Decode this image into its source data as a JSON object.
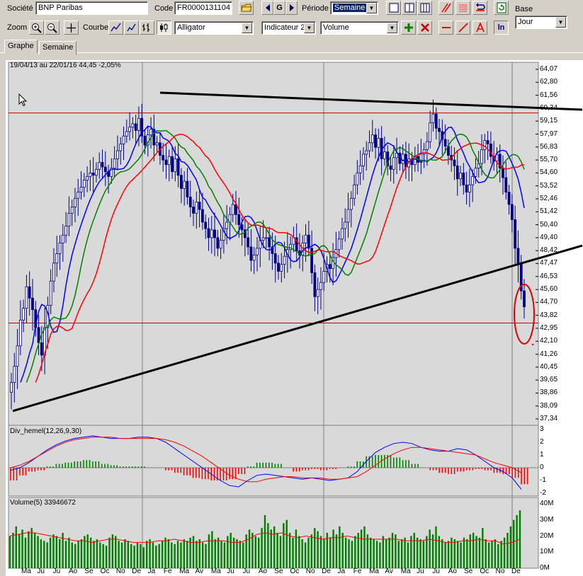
{
  "toolbar": {
    "company_label": "Société",
    "company_value": "BNP Paribas",
    "code_label": "Code",
    "code_value": "FR0000131104",
    "nav_g": "G",
    "period_label": "Période",
    "period_value": "Semaine",
    "base_label": "Base",
    "base_value": "Jour",
    "zoom_label": "Zoom",
    "curve_label": "Courbe",
    "overlay_value": "Alligator",
    "indicator_value": "Indicateur 2",
    "indicator2_value": "Volume",
    "ln_label": "ln"
  },
  "tabs": [
    {
      "label": "Graphe"
    },
    {
      "label": "Semaine"
    }
  ],
  "main_header": "19/04/13 au 22/01/16  44,45  -2,05%",
  "macd_header": "Div_hemel(12,26,9,30)",
  "volume_header": "Volume(5) 33946672",
  "colors": {
    "price_body": "#000080",
    "alligator_blue": "#0000ff",
    "alligator_green": "#008000",
    "alligator_red": "#ff0000",
    "hist_pos": "#008000",
    "hist_neg": "#ff0000",
    "volume_bar": "#008000",
    "volume_avg": "#ff0000",
    "trend_line": "#000000",
    "horizontal_line": "#c00000",
    "panel_bg": "#d9d9d9"
  },
  "chart_data": [
    {
      "type": "candlestick",
      "title": "19/04/13 au 22/01/16  44,45  -2,05%",
      "ylim": [
        37.34,
        64.07
      ],
      "yticks": [
        "64,07",
        "62,80",
        "61,56",
        "60,34",
        "59,15",
        "57,97",
        "56,83",
        "55,70",
        "54,60",
        "53,52",
        "52,46",
        "51,42",
        "50,40",
        "49,40",
        "48,42",
        "47,47",
        "46,53",
        "45,60",
        "44,70",
        "43,82",
        "42,95",
        "42,10",
        "41,26",
        "40,45",
        "39,65",
        "38,86",
        "38,09",
        "37,34"
      ],
      "xticks": [
        "Ma",
        "Ju",
        "Ju",
        "Ao",
        "Se",
        "Oc",
        "No",
        "De",
        "Ja",
        "Fe",
        "Ma",
        "Av",
        "Ma",
        "Ju",
        "Ju",
        "Ao",
        "Se",
        "Oc",
        "No",
        "De",
        "Ja",
        "Fe",
        "Ma",
        "Av",
        "Ma",
        "Ju",
        "Ju",
        "Ao",
        "Se",
        "Oc",
        "No",
        "De"
      ],
      "close": [
        39.5,
        40.5,
        41.8,
        43.5,
        44.3,
        45.8,
        45.0,
        44.2,
        43.0,
        42.0,
        41.2,
        43.0,
        44.5,
        46.2,
        47.5,
        48.2,
        49.0,
        49.6,
        50.3,
        51.3,
        51.8,
        52.5,
        53.0,
        53.4,
        54.0,
        54.3,
        54.6,
        54.4,
        54.9,
        55.5,
        55.1,
        54.7,
        54.3,
        55.0,
        55.8,
        56.5,
        57.1,
        57.8,
        58.2,
        58.6,
        58.9,
        58.3,
        59.4,
        57.8,
        57.0,
        57.9,
        58.4,
        57.0,
        57.2,
        56.1,
        55.7,
        55.3,
        56.0,
        54.7,
        55.8,
        54.4,
        53.3,
        53.9,
        52.6,
        51.8,
        51.3,
        52.2,
        51.6,
        50.6,
        50.1,
        49.4,
        50.0,
        49.4,
        48.6,
        49.2,
        50.1,
        50.6,
        51.2,
        52.0,
        51.2,
        50.4,
        50.0,
        49.4,
        48.7,
        47.7,
        48.1,
        48.6,
        49.2,
        49.4,
        49.4,
        48.7,
        48.2,
        47.5,
        46.9,
        47.4,
        48.0,
        48.5,
        48.9,
        49.4,
        48.4,
        48.1,
        49.0,
        49.6,
        48.6,
        46.8,
        45.1,
        45.6,
        46.1,
        46.9,
        47.4,
        47.1,
        47.9,
        48.5,
        49.3,
        50.1,
        50.6,
        51.6,
        52.5,
        53.6,
        54.6,
        55.2,
        56.2,
        56.5,
        57.2,
        57.9,
        56.8,
        57.6,
        55.8,
        56.4,
        55.2,
        54.9,
        55.9,
        56.3,
        55.4,
        56.2,
        55.1,
        55.8,
        55.3,
        56.0,
        55.5,
        56.2,
        56.6,
        57.3,
        59.0,
        59.8,
        58.5,
        58.2,
        57.5,
        56.9,
        56.1,
        55.7,
        55.2,
        54.1,
        54.6,
        53.6,
        53.0,
        53.6,
        54.3,
        55.0,
        55.4,
        56.6,
        57.4,
        57.1,
        56.0,
        55.6,
        56.2,
        55.0,
        54.2,
        53.0,
        52.0,
        50.8,
        48.6,
        47.5,
        45.5,
        44.4
      ],
      "horizontal_lines": [
        59.9,
        43.3
      ],
      "trend_lines": [
        {
          "from": [
            "2014-01",
            61.8
          ],
          "to": [
            "2016-01",
            60.2
          ]
        },
        {
          "from": [
            "2013-04",
            37.8
          ],
          "to": [
            "2016-01",
            48.8
          ]
        }
      ],
      "series": [
        {
          "name": "Alligator (blue)",
          "color": "#0000ff"
        },
        {
          "name": "Alligator (green)",
          "color": "#008000"
        },
        {
          "name": "Alligator (red)",
          "color": "#ff0000"
        }
      ],
      "annotation": "red ellipse around last candle"
    },
    {
      "type": "bar",
      "title": "Div_hemel(12,26,9,30)",
      "ylim": [
        -2,
        3
      ],
      "yticks": [
        "3",
        "2",
        "1",
        "0",
        "-1",
        "-2"
      ],
      "macd": [
        -0.2,
        0.0,
        0.4,
        0.9,
        1.4,
        1.8,
        2.1,
        2.3,
        2.4,
        2.5,
        2.4,
        2.3,
        2.3,
        2.3,
        2.4,
        2.4,
        2.3,
        2.0,
        1.5,
        1.0,
        0.5,
        0.0,
        -0.5,
        -1.0,
        -1.4,
        -1.5,
        -1.0,
        -0.6,
        -0.5,
        -0.6,
        -0.7,
        -0.8,
        -0.9,
        -0.8,
        -0.9,
        -1.0,
        -0.9,
        -0.8,
        -0.3,
        0.5,
        1.2,
        1.6,
        1.9,
        2.0,
        1.9,
        1.6,
        1.4,
        1.3,
        1.3,
        1.5,
        1.4,
        1.0,
        0.5,
        0.0,
        -0.3,
        -0.8,
        -1.7
      ],
      "signal": [
        0.0,
        0.2,
        0.5,
        0.9,
        1.3,
        1.7,
        2.0,
        2.2,
        2.3,
        2.4,
        2.4,
        2.4,
        2.3,
        2.3,
        2.3,
        2.3,
        2.3,
        2.2,
        2.0,
        1.7,
        1.3,
        0.9,
        0.4,
        -0.1,
        -0.6,
        -0.9,
        -1.1,
        -1.1,
        -0.9,
        -0.8,
        -0.7,
        -0.7,
        -0.8,
        -0.8,
        -0.8,
        -0.9,
        -0.9,
        -0.8,
        -0.7,
        -0.3,
        0.2,
        0.7,
        1.1,
        1.4,
        1.6,
        1.6,
        1.5,
        1.4,
        1.3,
        1.2,
        1.1,
        1.0,
        0.7,
        0.4,
        0.2,
        0.0,
        -0.4
      ],
      "histogram": [
        -1.0,
        -0.6,
        -0.3,
        -0.2,
        0.1,
        0.3,
        0.4,
        0.5,
        0.6,
        0.5,
        0.3,
        0.2,
        0.1,
        0.1,
        0.1,
        0.0,
        0.0,
        -0.2,
        -0.4,
        -0.6,
        -0.8,
        -0.9,
        -1.0,
        -1.0,
        -0.9,
        -0.5,
        0.1,
        0.4,
        0.4,
        0.3,
        0.0,
        -0.3,
        -0.2,
        -0.1,
        -0.2,
        -0.1,
        0.0,
        0.1,
        0.5,
        0.9,
        1.0,
        1.0,
        0.8,
        0.6,
        0.3,
        0.0,
        -0.2,
        -0.4,
        -0.5,
        -0.3,
        -0.2,
        -0.1,
        -0.2,
        -0.4,
        -0.5,
        -0.8,
        -1.3
      ]
    },
    {
      "type": "bar",
      "title": "Volume(5) 33946672",
      "ylim": [
        0,
        40
      ],
      "yticks": [
        "40M",
        "30M",
        "20M",
        "10M",
        "0M"
      ],
      "volume": [
        20,
        22,
        26,
        21,
        24,
        19,
        23,
        25,
        22,
        20,
        18,
        17,
        16,
        19,
        21,
        20,
        18,
        22,
        17,
        19,
        16,
        15,
        17,
        18,
        20,
        21,
        19,
        17,
        18,
        16,
        15,
        14,
        19,
        21,
        20,
        17,
        16,
        18,
        17,
        15,
        14,
        16,
        15,
        13,
        17,
        18,
        16,
        14,
        15,
        17,
        19,
        18,
        16,
        15,
        17,
        16,
        18,
        17,
        19,
        20,
        17,
        18,
        16,
        15,
        21,
        23,
        18,
        19,
        17,
        16,
        20,
        22,
        19,
        18,
        17,
        16,
        21,
        24,
        22,
        20,
        19,
        25,
        33,
        28,
        24,
        26,
        22,
        20,
        28,
        30,
        22,
        19,
        24,
        20,
        18,
        16,
        19,
        21,
        25,
        23,
        20,
        18,
        22,
        19,
        24,
        21,
        26,
        22,
        19,
        18,
        17,
        20,
        22,
        24,
        26,
        21,
        19,
        18,
        17,
        16,
        20,
        18,
        19,
        22,
        21,
        17,
        18,
        19,
        16,
        20,
        22,
        19,
        18,
        17,
        20,
        24,
        21,
        26,
        20,
        18,
        16,
        17,
        19,
        18,
        17,
        16,
        19,
        18,
        21,
        22,
        20,
        19,
        25,
        18,
        16,
        17,
        18,
        15,
        17,
        19,
        22,
        26,
        30,
        33,
        36
      ],
      "volume_avg": [
        20,
        21,
        22,
        22,
        21,
        20,
        19,
        18,
        17,
        17,
        16,
        17,
        18,
        18,
        17,
        16,
        16,
        16,
        17,
        17,
        18,
        17,
        16,
        16,
        17,
        17,
        17,
        16,
        16,
        18,
        21,
        22,
        21,
        22,
        20,
        19,
        20,
        19,
        18,
        19,
        19,
        20,
        19,
        18,
        18,
        18,
        18,
        18,
        17,
        17,
        17,
        18,
        17,
        16,
        16,
        17,
        17,
        18,
        17,
        17,
        15,
        16,
        18
      ]
    }
  ]
}
